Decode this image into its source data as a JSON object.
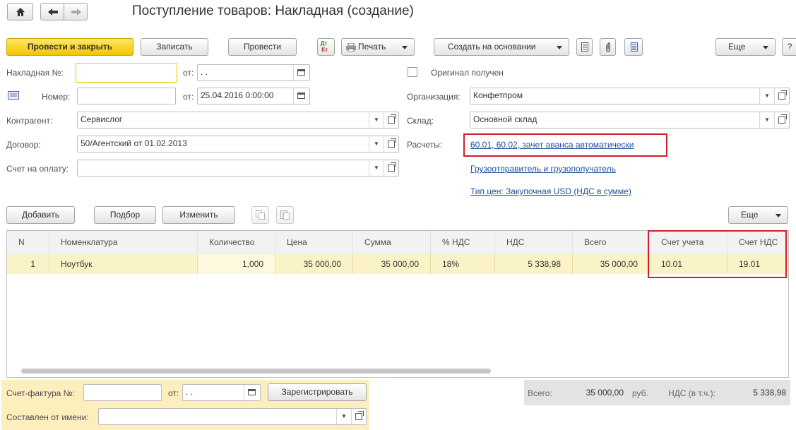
{
  "window": {
    "title": "Поступление товаров: Накладная (создание)"
  },
  "toolbar": {
    "post_close": "Провести и закрыть",
    "save": "Записать",
    "post": "Провести",
    "print": "Печать",
    "create_based": "Создать на основании",
    "more": "Еще",
    "help": "?"
  },
  "header": {
    "invoice_no_label": "Накладная №:",
    "invoice_no_value": "",
    "from_label": "от:",
    "invoice_date": " .  .",
    "number_label": "Номер:",
    "number_value": "",
    "doc_date": "25.04.2016  0:00:00",
    "original_label": "Оригинал получен",
    "org_label": "Организация:",
    "org_value": "Конфетпром",
    "contractor_label": "Контрагент:",
    "contractor_value": "Сервислог",
    "warehouse_label": "Склад:",
    "warehouse_value": "Основной склад",
    "contract_label": "Договор:",
    "contract_value": "50/Агентский от 01.02.2013",
    "settlements_label": "Расчеты:",
    "settlements_link": "60.01, 60.02, зачет аванса автоматически",
    "payment_label": "Счет на оплату:",
    "payment_value": "",
    "shipper_link": "Грузоотправитель и грузополучатель",
    "price_type_link": "Тип цен: Закупочная USD (НДС в сумме)"
  },
  "table_toolbar": {
    "add": "Добавить",
    "select": "Подбор",
    "change": "Изменить",
    "more": "Еще"
  },
  "table": {
    "columns": [
      "N",
      "Номенклатура",
      "Количество",
      "Цена",
      "Сумма",
      "% НДС",
      "НДС",
      "Всего",
      "Счет учета",
      "Счет НДС"
    ],
    "rows": [
      [
        "1",
        "Ноутбук",
        "1,000",
        "35 000,00",
        "35 000,00",
        "18%",
        "5 338,98",
        "35 000,00",
        "10.01",
        "19.01"
      ]
    ]
  },
  "footer": {
    "sf_label": "Счет-фактура №:",
    "sf_value": "",
    "sf_from": "от:",
    "sf_date": " .  .",
    "register": "Зарегистрировать",
    "made_by_label": "Составлен от имени:",
    "made_by_value": "",
    "total_label": "Всего:",
    "total_value": "35 000,00",
    "currency": "руб.",
    "vat_label": "НДС (в т.ч.):",
    "vat_value": "5 338,98"
  }
}
